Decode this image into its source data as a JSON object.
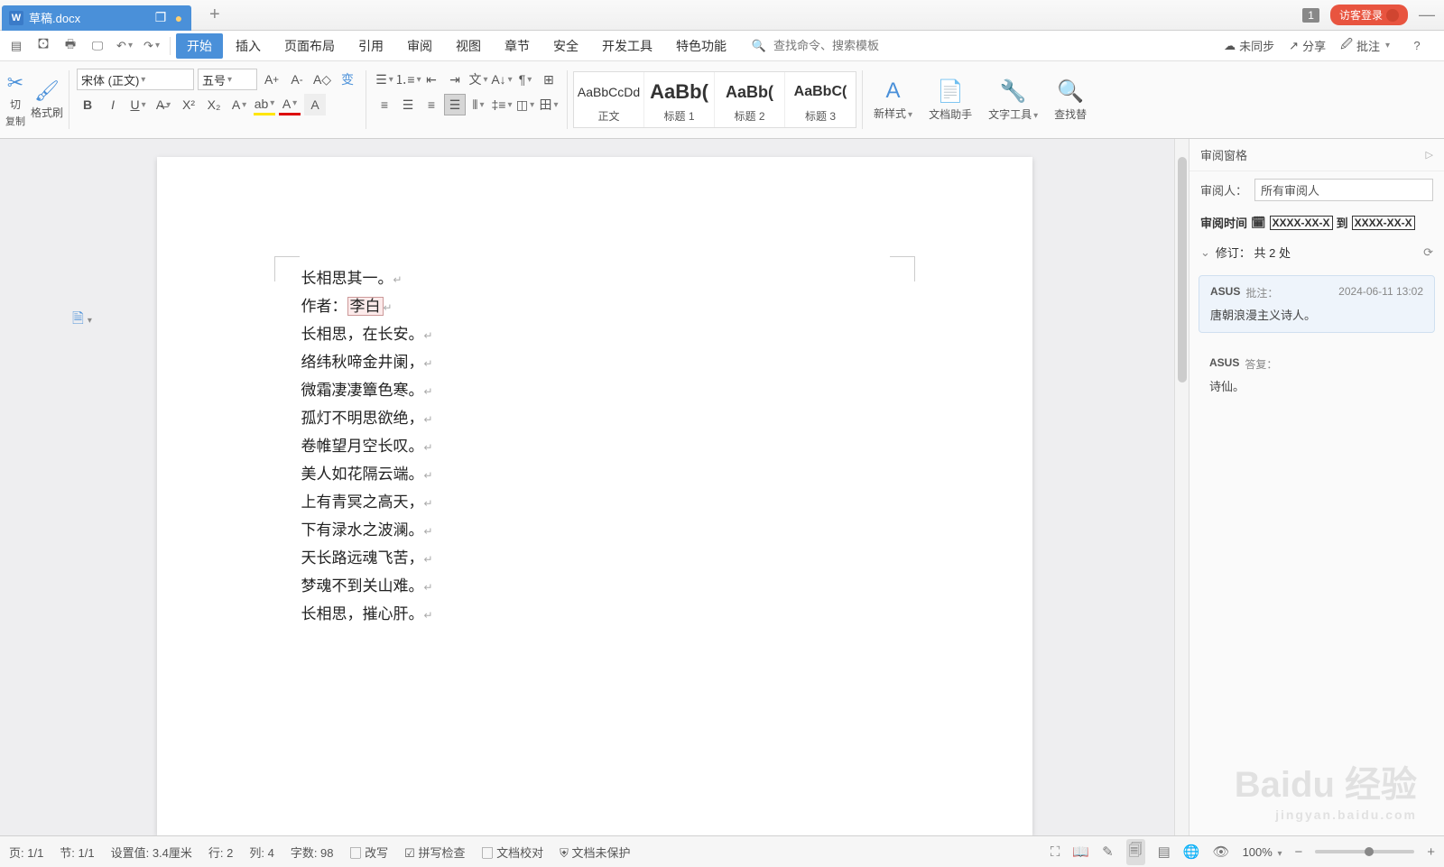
{
  "titlebar": {
    "doc_name": "草稿.docx",
    "badge": "1",
    "login": "访客登录"
  },
  "menubar": {
    "tabs": [
      "开始",
      "插入",
      "页面布局",
      "引用",
      "审阅",
      "视图",
      "章节",
      "安全",
      "开发工具",
      "特色功能"
    ],
    "search_placeholder": "查找命令、搜索模板",
    "unsynced": "未同步",
    "share": "分享",
    "comment": "批注"
  },
  "ribbon": {
    "cut": "切",
    "copy": "复制",
    "format_painter": "格式刷",
    "font_name": "宋体 (正文)",
    "font_size": "五号",
    "styles": [
      {
        "preview": "AaBbCcDd",
        "name": "正文"
      },
      {
        "preview": "AaBb(",
        "name": "标题 1"
      },
      {
        "preview": "AaBb(",
        "name": "标题 2"
      },
      {
        "preview": "AaBbC(",
        "name": "标题 3"
      }
    ],
    "new_style": "新样式",
    "doc_helper": "文档助手",
    "text_tools": "文字工具",
    "find_replace": "查找替"
  },
  "document": {
    "lines": [
      "长相思其一。",
      "作者：",
      "长相思，在长安。",
      "络纬秋啼金井阑，",
      "微霜凄凄簟色寒。",
      "孤灯不明思欲绝，",
      "卷帷望月空长叹。",
      "美人如花隔云端。",
      "上有青冥之高天，",
      "下有渌水之波澜。",
      "天长路远魂飞苦，",
      "梦魂不到关山难。",
      "长相思，摧心肝。"
    ],
    "author_value": "李白"
  },
  "review_pane": {
    "title": "审阅窗格",
    "reviewer_label": "审阅人：",
    "reviewer_sel": "所有审阅人",
    "time_label": "审阅时间",
    "date_from": "XXXX-XX-X",
    "date_mid": "到",
    "date_to": "XXXX-XX-X",
    "revisions_label": "修订：",
    "revisions_count": "共 2 处",
    "comments": [
      {
        "user": "ASUS",
        "type": "批注：",
        "time": "2024-06-11 13:02",
        "body": "唐朝浪漫主义诗人。"
      },
      {
        "user": "ASUS",
        "type": "答复：",
        "time": "",
        "body": "诗仙。"
      }
    ]
  },
  "statusbar": {
    "page": "页: 1/1",
    "section": "节: 1/1",
    "setup": "设置值: 3.4厘米",
    "row": "行: 2",
    "col": "列: 4",
    "words": "字数: 98",
    "overwrite": "改写",
    "spell": "拼写检查",
    "proof": "文档校对",
    "protect": "文档未保护",
    "zoom": "100%"
  },
  "watermark": {
    "main": "Baidu 经验",
    "sub": "jingyan.baidu.com"
  }
}
